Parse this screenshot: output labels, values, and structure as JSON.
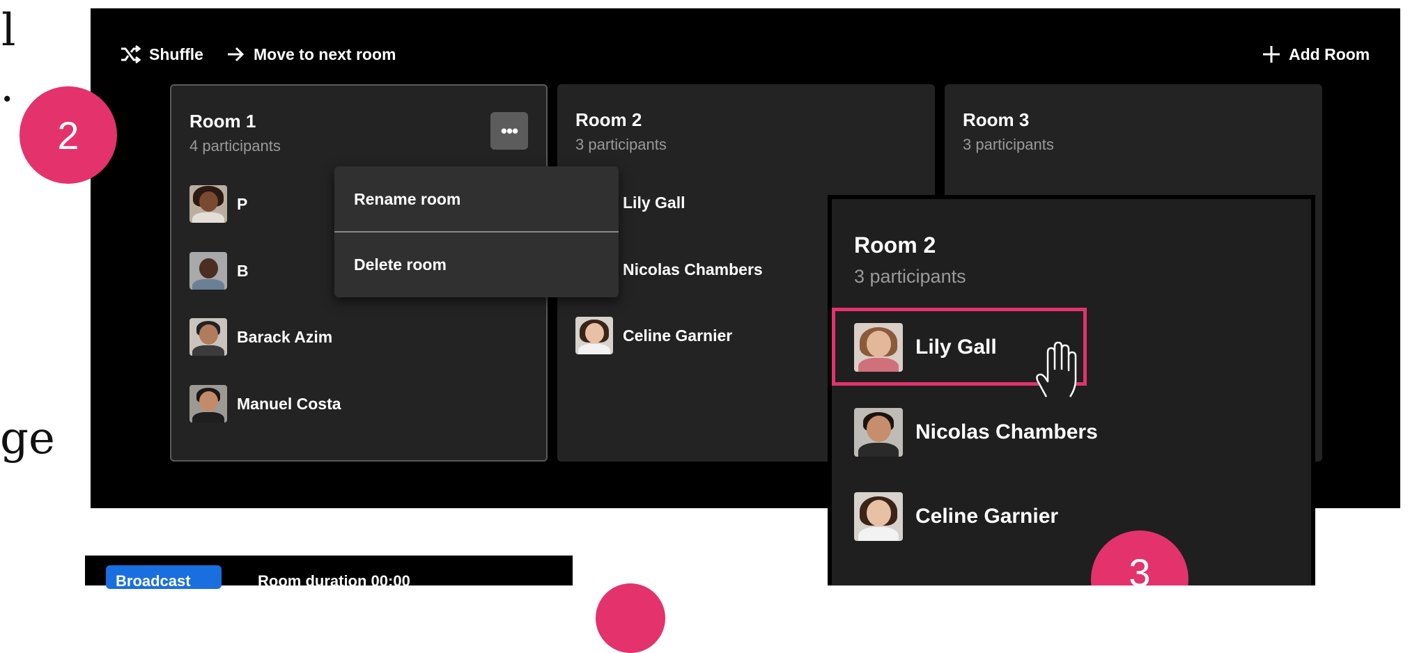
{
  "left_edge": {
    "line1": "l",
    "line2": ".",
    "line3": "ge"
  },
  "toolbar": {
    "shuffle_label": "Shuffle",
    "move_label": "Move to next room",
    "add_room_label": "Add Room"
  },
  "rooms": [
    {
      "title": "Room 1",
      "count": "4 participants",
      "participants": [
        {
          "name": "P"
        },
        {
          "name": "B"
        },
        {
          "name": "Barack Azim"
        },
        {
          "name": "Manuel Costa"
        }
      ]
    },
    {
      "title": "Room 2",
      "count": "3 participants",
      "participants": [
        {
          "name": "Lily Gall"
        },
        {
          "name": "Nicolas Chambers"
        },
        {
          "name": "Celine Garnier"
        }
      ]
    },
    {
      "title": "Room 3",
      "count": "3 participants",
      "participants": []
    }
  ],
  "room_menu": {
    "more_label": "•••",
    "rename_label": "Rename room",
    "delete_label": "Delete room"
  },
  "badges": {
    "step2": "2",
    "step3": "3"
  },
  "zoom_card": {
    "title": "Room 2",
    "count": "3 participants",
    "participants": [
      {
        "name": "Lily Gall"
      },
      {
        "name": "Nicolas Chambers"
      },
      {
        "name": "Celine Garnier"
      }
    ]
  },
  "bottom_bar": {
    "button_label": "Broadcast",
    "text": "Room duration 00:00"
  },
  "colors": {
    "accent_pink": "#e4326d",
    "panel_bg": "#000000",
    "room_bg": "#232323",
    "primary_blue": "#1a6fe0"
  }
}
